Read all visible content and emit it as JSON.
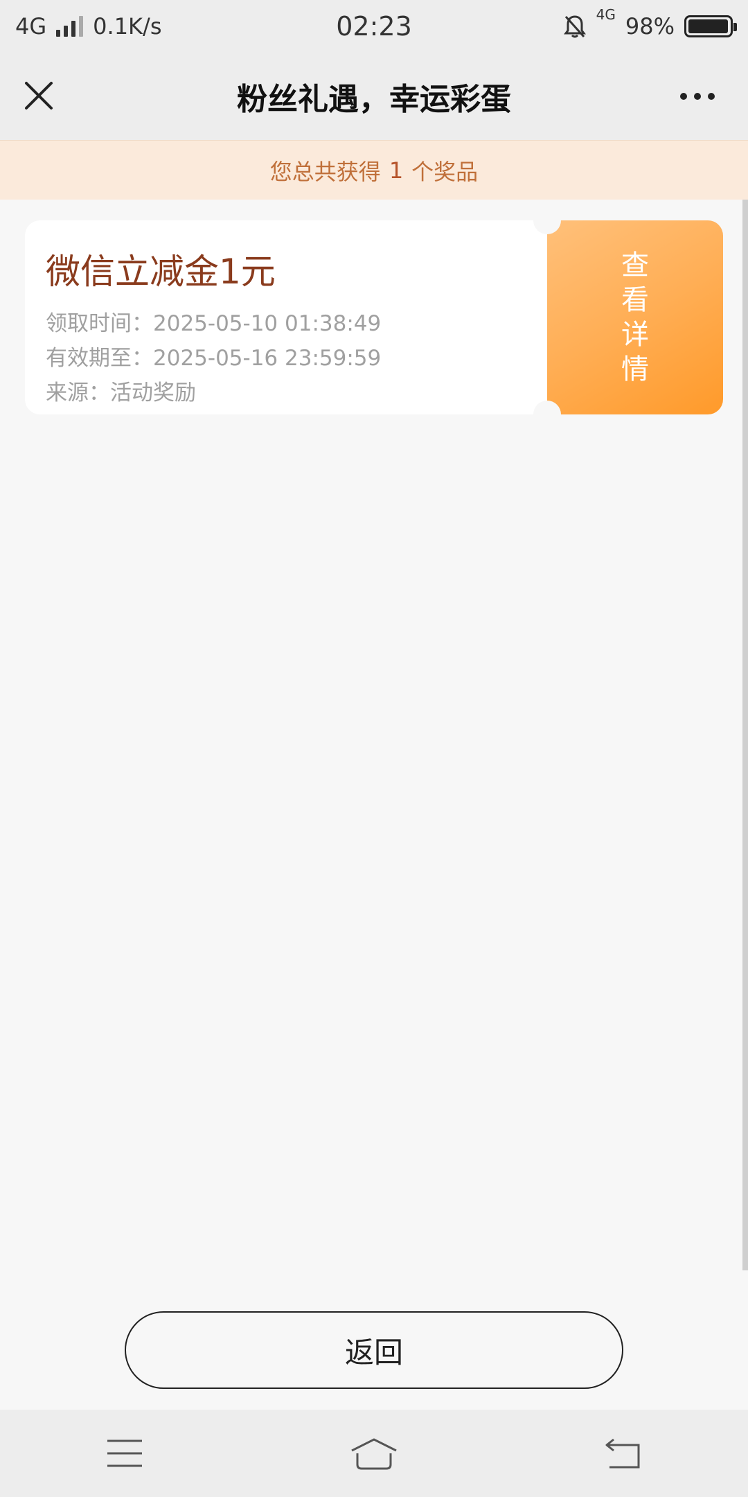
{
  "status_bar": {
    "network": "4G",
    "speed": "0.1K/s",
    "time": "02:23",
    "network_right": "4G",
    "battery": "98%"
  },
  "nav": {
    "title": "粉丝礼遇，幸运彩蛋",
    "close_icon": "close-icon",
    "more_icon": "more-icon"
  },
  "banner": {
    "prefix": "您总共获得",
    "count": "1",
    "suffix": "个奖品"
  },
  "coupons": [
    {
      "title": "微信立减金1元",
      "received_time": "领取时间：2025-05-10 01:38:49",
      "valid_until": "有效期至：2025-05-16 23:59:59",
      "source": "来源：活动奖励",
      "action_label": "查看详情"
    }
  ],
  "back_button": {
    "label": "返回"
  },
  "colors": {
    "accent_orange": "#ff9a2a",
    "title_brown": "#8a3b1d",
    "banner_bg": "#fbeadb"
  }
}
